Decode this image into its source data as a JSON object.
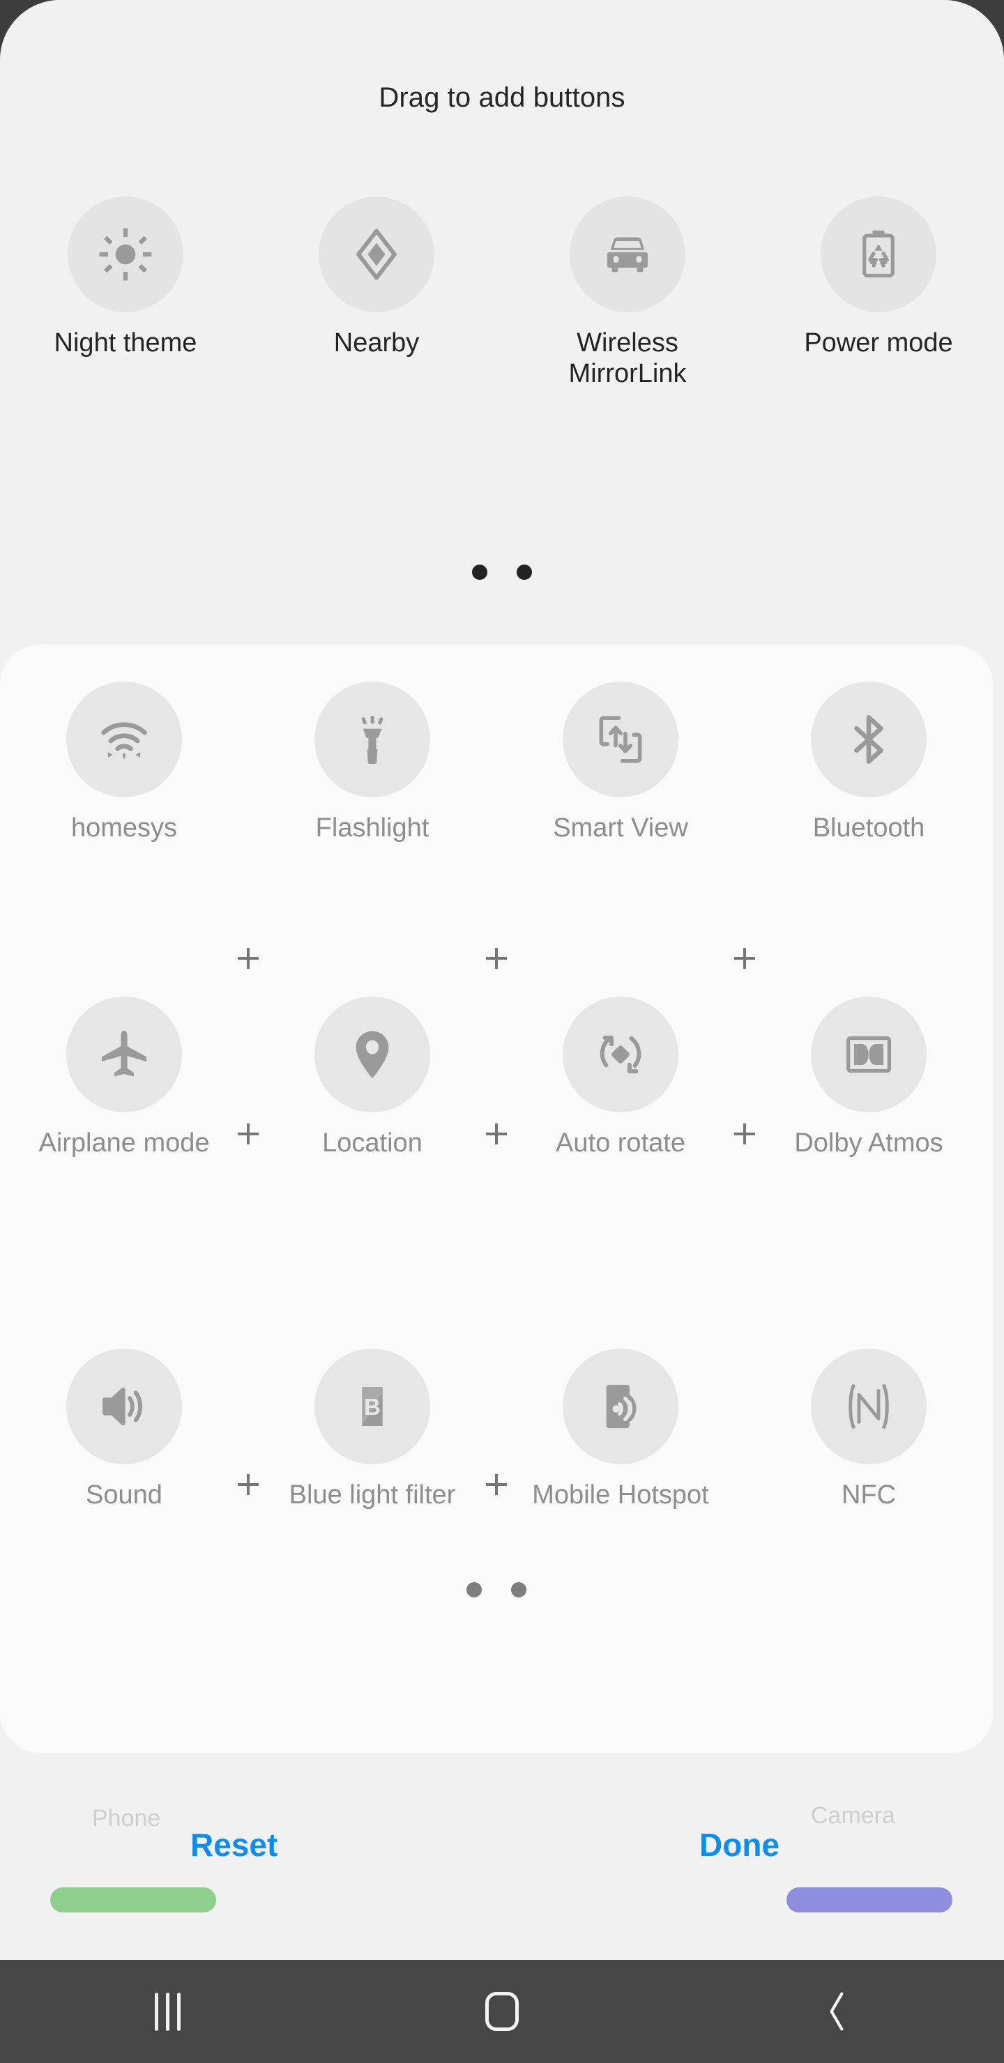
{
  "screen": {
    "title": "Drag to add buttons",
    "colors": {
      "page_bg": "#f1f1f1",
      "panel_bg": "#fafafa",
      "icon_circle": "#e4e4e4",
      "icon_glyph": "#9a9a9a",
      "accent_blue": "#108de8",
      "bezel": "#3d3d3d",
      "navbar": "#464646",
      "phone_pill": "#8fce8b",
      "camera_pill": "#8f8ede"
    }
  },
  "available_panel": {
    "title": "Drag to add buttons",
    "tiles": [
      {
        "label": "Night theme",
        "icon": "brightness-sun-icon"
      },
      {
        "label": "Nearby",
        "icon": "nearby-share-diamond-icon"
      },
      {
        "label": "Wireless MirrorLink",
        "icon": "car-icon"
      },
      {
        "label": "Power mode",
        "icon": "battery-recycle-icon"
      }
    ],
    "page_dots": {
      "count": 2,
      "active_index": 0
    }
  },
  "active_panel": {
    "rows": [
      [
        {
          "label": "homesys",
          "icon": "wifi-icon"
        },
        {
          "label": "Flashlight",
          "icon": "flashlight-icon"
        },
        {
          "label": "Smart View",
          "icon": "smart-view-icon"
        },
        {
          "label": "Bluetooth",
          "icon": "bluetooth-icon"
        }
      ],
      [
        {
          "label": "Airplane mode",
          "icon": "airplane-icon"
        },
        {
          "label": "Location",
          "icon": "location-pin-icon"
        },
        {
          "label": "Auto rotate",
          "icon": "auto-rotate-icon"
        },
        {
          "label": "Dolby Atmos",
          "icon": "dolby-atmos-icon"
        }
      ],
      [
        {
          "label": "Sound",
          "icon": "sound-speaker-icon"
        },
        {
          "label": "Blue light filter",
          "icon": "blue-light-filter-icon"
        },
        {
          "label": "Mobile Hotspot",
          "icon": "mobile-hotspot-icon"
        },
        {
          "label": "NFC",
          "icon": "nfc-icon"
        }
      ]
    ],
    "add_markers": {
      "symbol": "+",
      "count_per_row": 3
    },
    "page_dots": {
      "count": 2,
      "active_index": 0
    }
  },
  "action_bar": {
    "reset_label": "Reset",
    "done_label": "Done",
    "ghost_left_label": "Phone",
    "ghost_right_label": "Camera"
  },
  "navigation_bar": {
    "recents_label": "Recents",
    "home_label": "Home",
    "back_label": "Back",
    "back_glyph": "‹"
  }
}
